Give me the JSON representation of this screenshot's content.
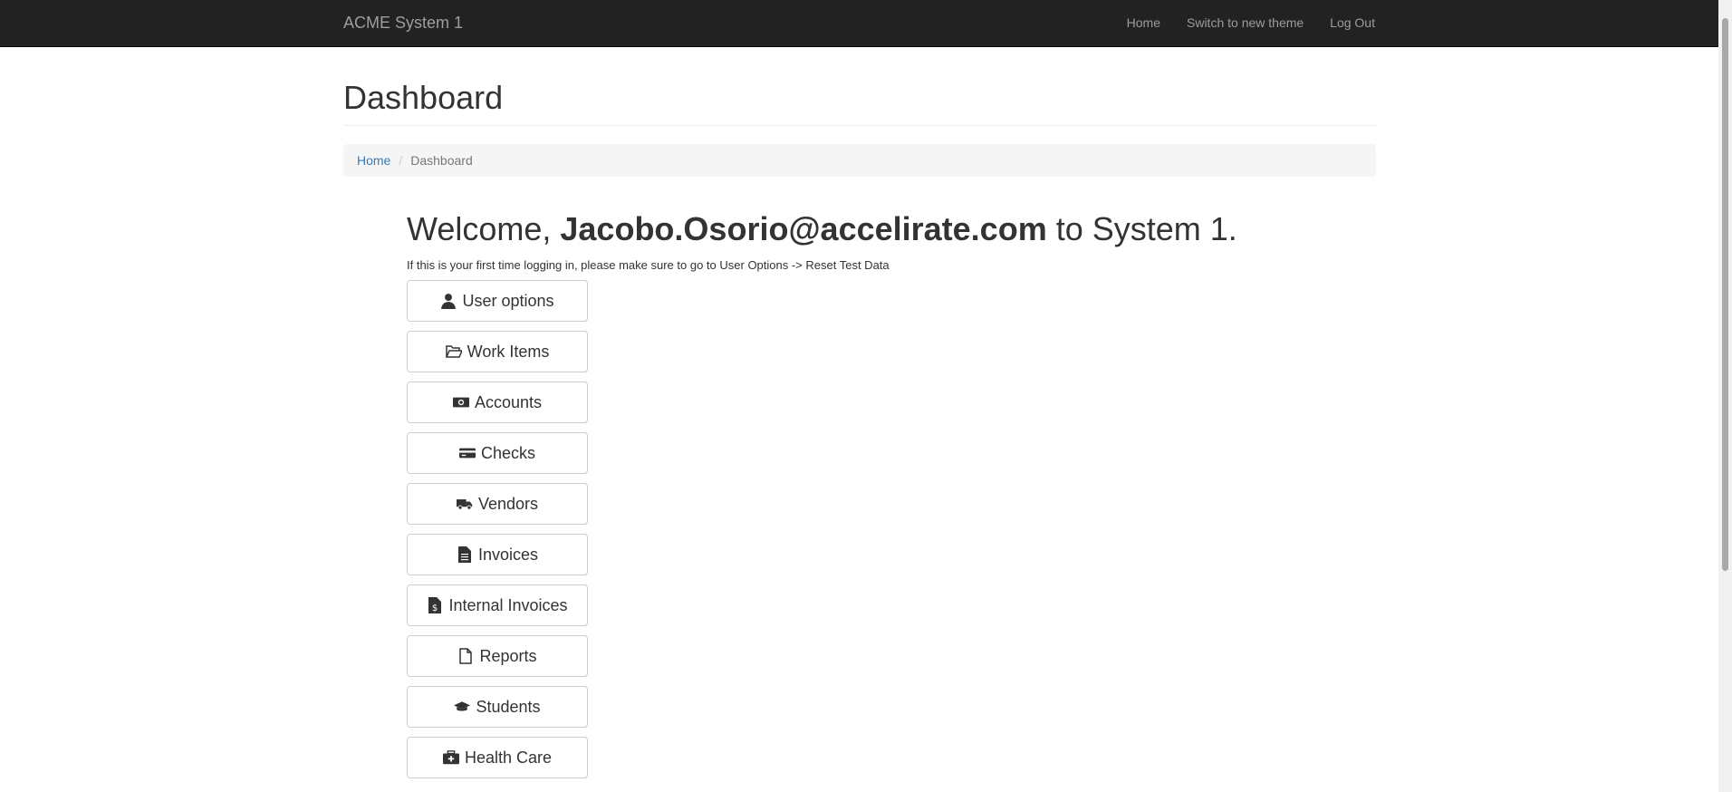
{
  "navbar": {
    "brand": "ACME System 1",
    "links": [
      "Home",
      "Switch to new theme",
      "Log Out"
    ]
  },
  "page": {
    "title": "Dashboard"
  },
  "breadcrumb": {
    "home": "Home",
    "separator": "/",
    "current": "Dashboard"
  },
  "welcome": {
    "prefix": "Welcome, ",
    "user": "Jacobo.Osorio@accelirate.com",
    "suffix": " to System 1.",
    "note": "If this is your first time logging in, please make sure to go to User Options -> Reset Test Data"
  },
  "buttons": [
    {
      "label": "User options",
      "icon": "user-icon"
    },
    {
      "label": "Work Items",
      "icon": "folder-open-icon"
    },
    {
      "label": "Accounts",
      "icon": "money-icon"
    },
    {
      "label": "Checks",
      "icon": "credit-card-icon"
    },
    {
      "label": "Vendors",
      "icon": "truck-icon"
    },
    {
      "label": "Invoices",
      "icon": "file-text-icon"
    },
    {
      "label": "Internal Invoices",
      "icon": "file-invoice-dollar-icon"
    },
    {
      "label": "Reports",
      "icon": "file-icon"
    },
    {
      "label": "Students",
      "icon": "graduation-cap-icon"
    },
    {
      "label": "Health Care",
      "icon": "medkit-icon"
    }
  ],
  "colors": {
    "navbar_bg": "#222222",
    "navbar_text": "#9d9d9d",
    "link": "#337ab7",
    "breadcrumb_bg": "#f5f5f5"
  }
}
